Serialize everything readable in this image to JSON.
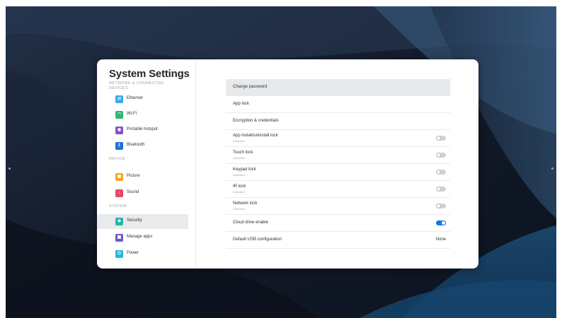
{
  "window_title": "System Settings",
  "sidebar": {
    "sections": [
      {
        "label": "NETWORK & CONNECTED DEVICES",
        "items": [
          {
            "label": "Ethernet",
            "icon": "ethernet-icon",
            "color": "#3fa9e6"
          },
          {
            "label": "Wi-Fi",
            "icon": "wifi-icon",
            "color": "#2fb872"
          },
          {
            "label": "Portable hotspot",
            "icon": "hotspot-icon",
            "color": "#7e57c2"
          },
          {
            "label": "Bluetooth",
            "icon": "bluetooth-icon",
            "color": "#1e6fd9"
          }
        ]
      },
      {
        "label": "DEVICE",
        "items": [
          {
            "label": "Picture",
            "icon": "picture-icon",
            "color": "#f5a623"
          },
          {
            "label": "Sound",
            "icon": "sound-icon",
            "color": "#e8456b"
          }
        ]
      },
      {
        "label": "SYSTEM",
        "items": [
          {
            "label": "Security",
            "icon": "shield-icon",
            "color": "#26b5a8",
            "active": true
          },
          {
            "label": "Manage apps",
            "icon": "apps-icon",
            "color": "#6a5acd"
          },
          {
            "label": "Power",
            "icon": "power-icon",
            "color": "#2fb6d8"
          }
        ]
      }
    ]
  },
  "settings": [
    {
      "title": "Change password",
      "selected": true
    },
    {
      "title": "App lock"
    },
    {
      "title": "Encryption & credentials"
    },
    {
      "title": "App install/uninstall lock",
      "subtitle": "Unlocked",
      "toggle": false
    },
    {
      "title": "Touch lock",
      "subtitle": "Unlocked",
      "toggle": false
    },
    {
      "title": "Keypad lock",
      "subtitle": "Unlocked",
      "toggle": false
    },
    {
      "title": "IR lock",
      "subtitle": "Unlocked",
      "toggle": false
    },
    {
      "title": "Network lock",
      "subtitle": "Unlocked",
      "toggle": false
    },
    {
      "title": "Cloud drive enable",
      "toggle": true
    },
    {
      "title": "Default USB configuration",
      "value": "None"
    }
  ]
}
